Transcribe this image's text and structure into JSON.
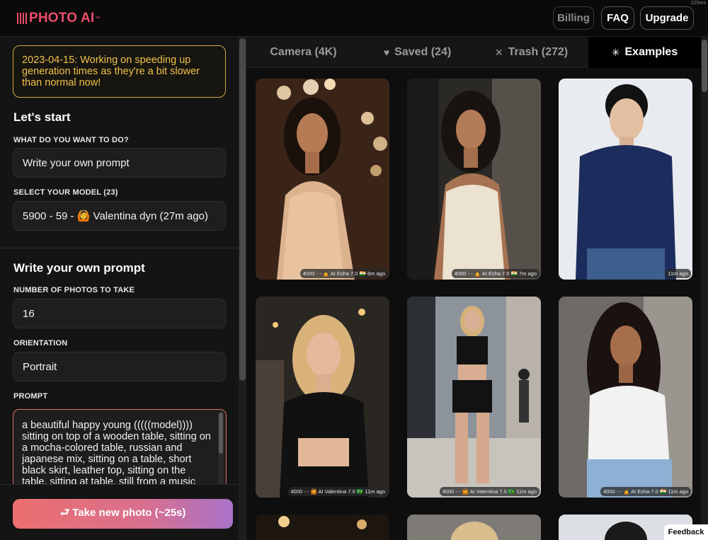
{
  "header": {
    "logo_text": "PHOTO AI",
    "logo_tm": "™",
    "corner_badge": "220ms",
    "billing_label": "Billing",
    "faq_label": "FAQ",
    "upgrade_label": "Upgrade"
  },
  "sidebar": {
    "notice": "2023-04-15: Working on speeding up generation times as they're a bit slower than normal now!",
    "start_title": "Let's start",
    "task_label": "WHAT DO YOU WANT TO DO?",
    "task_value": "Write your own prompt",
    "model_label": "SELECT YOUR MODEL (23)",
    "model_value": "5900 - 59 - 🙆 Valentina dyn (27m ago)",
    "prompt_section_title": "Write your own prompt",
    "count_label": "NUMBER OF PHOTOS TO TAKE",
    "count_value": "16",
    "orientation_label": "ORIENTATION",
    "orientation_value": "Portrait",
    "prompt_label": "PROMPT",
    "prompt_value": "a beautiful happy young (((((model)))) sitting on top of a wooden table, sitting on a mocha-colored table, russian and japanese mix, sitting on a table, short black skirt, leather top, sitting on the table, sitting at table, still from a music",
    "take_button": "⮐ Take new photo (~25s)"
  },
  "tabs": [
    {
      "label": "Camera (4K)",
      "icon": ""
    },
    {
      "label": "Saved (24)",
      "icon": "♥"
    },
    {
      "label": "Trash (272)",
      "icon": "✕"
    },
    {
      "label": "Examples",
      "icon": "✳"
    }
  ],
  "gallery": [
    {
      "meta": "4000 - - 🙍 AI Esha 7.0 🇮🇳 6m ago"
    },
    {
      "meta": "4000 - - 🙍 AI Esha 7.0 🇮🇳 7m ago"
    },
    {
      "meta": "11m ago"
    },
    {
      "meta": "4000 - - 🙆 AI Valentina 7.0 🇧🇷 11m ago"
    },
    {
      "meta": "4000 - - 🙆 AI Valentina 7.0 🇧🇷 11m ago"
    },
    {
      "meta": "4000 - - 🙍 AI Esha 7.0 🇮🇳 11m ago"
    }
  ],
  "feedback_label": "Feedback"
}
